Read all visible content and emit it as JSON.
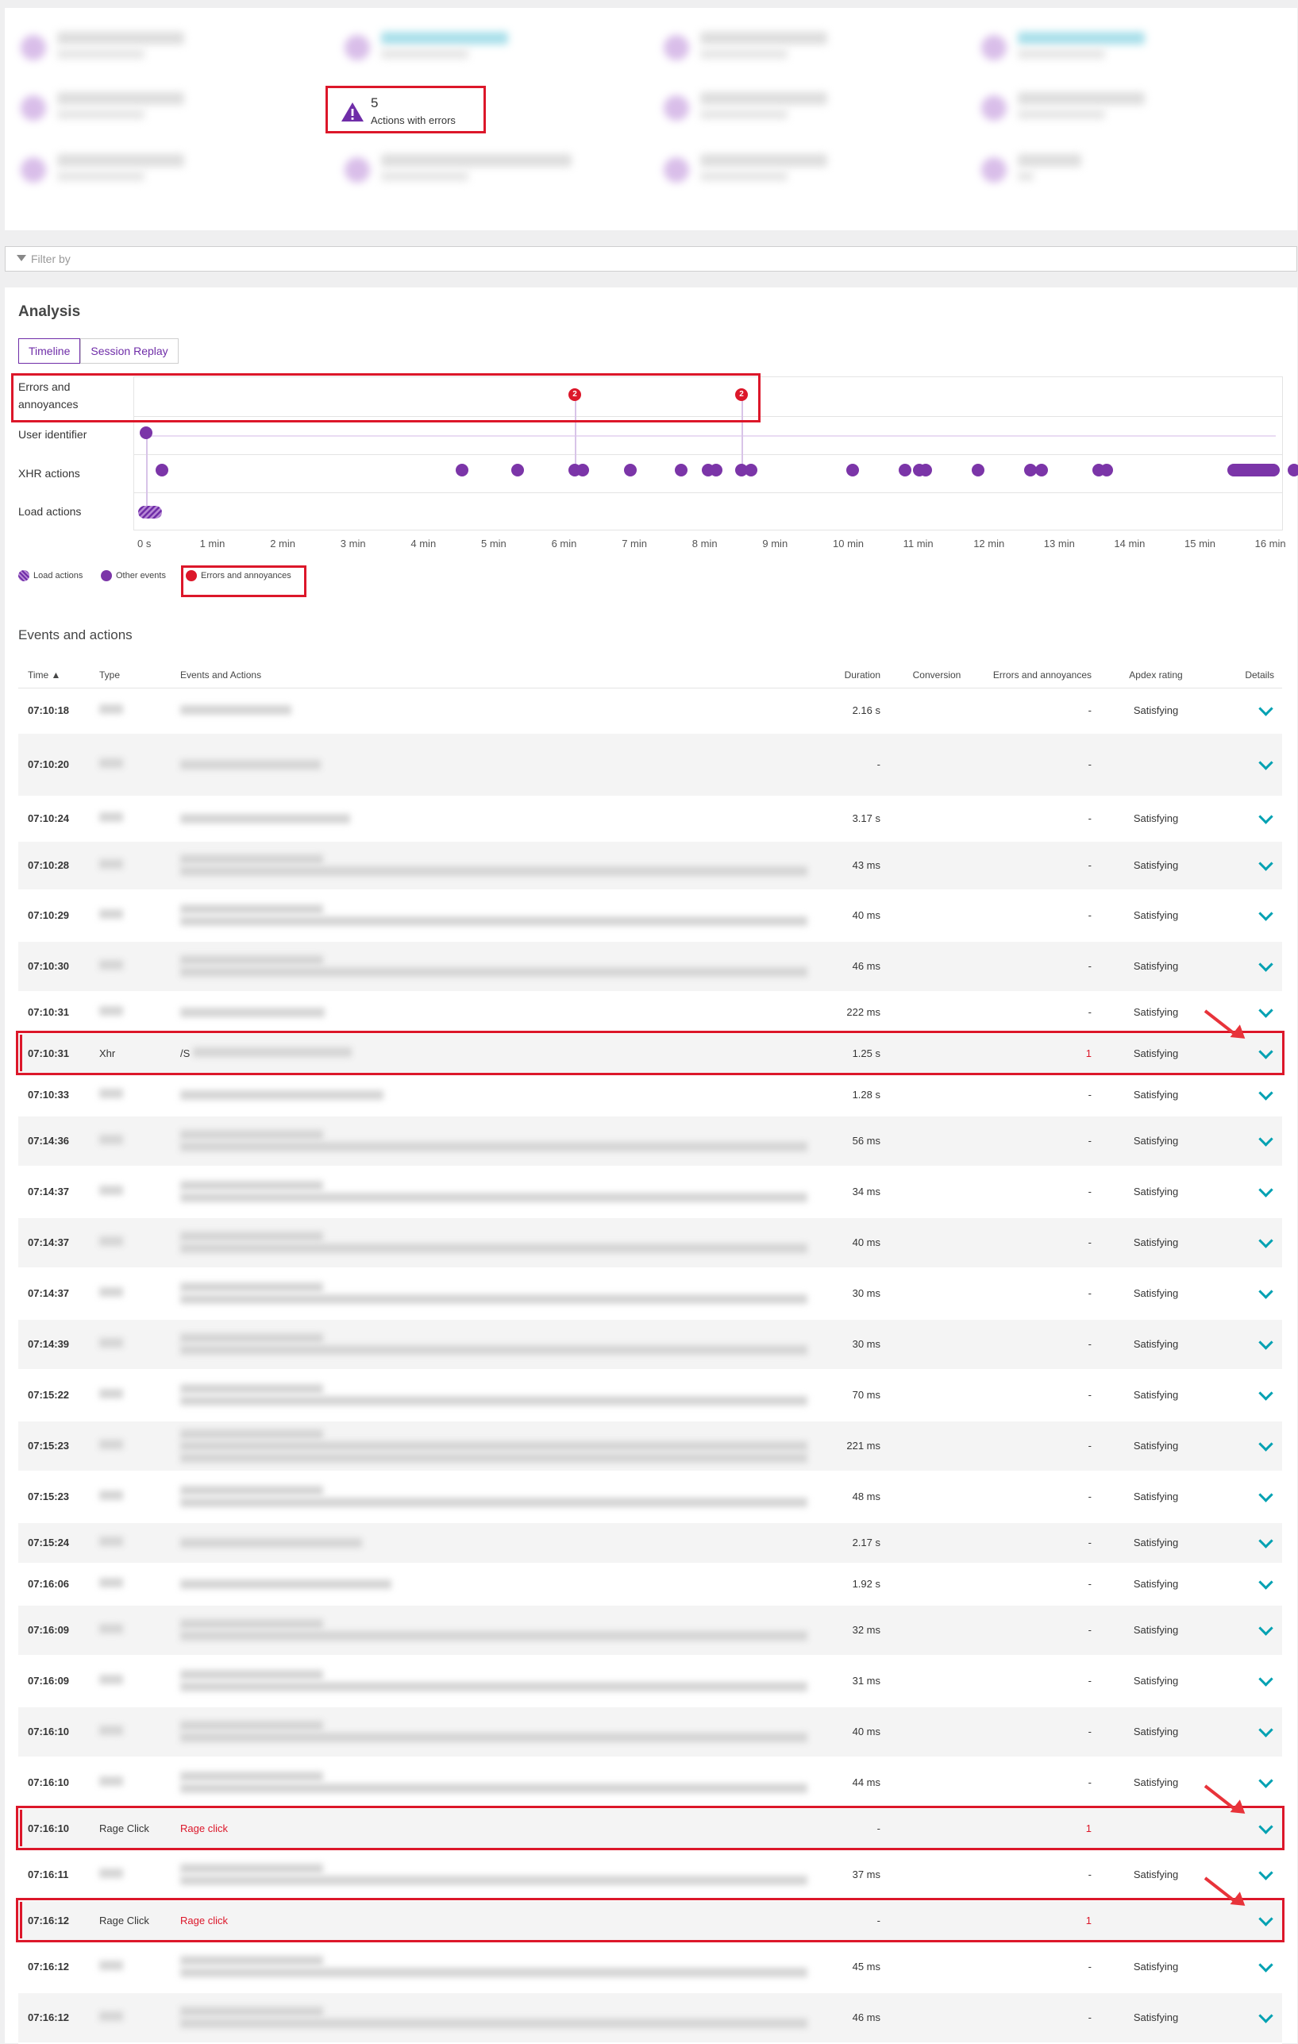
{
  "summary": {
    "highlight_value": "5",
    "highlight_label": "Actions with errors",
    "highlight_icon": "warning-triangle-icon"
  },
  "filter": {
    "placeholder": "Filter by"
  },
  "analysis": {
    "title": "Analysis",
    "tabs": [
      "Timeline",
      "Session Replay"
    ],
    "active_tab": "Timeline",
    "rows": [
      "Errors and annoyances",
      "User identifier",
      "XHR actions",
      "Load actions"
    ],
    "axis": [
      "0 s",
      "1 min",
      "2 min",
      "3 min",
      "4 min",
      "5 min",
      "6 min",
      "7 min",
      "8 min",
      "9 min",
      "10 min",
      "11 min",
      "12 min",
      "13 min",
      "14 min",
      "15 min",
      "16 min"
    ],
    "error_markers": [
      "2",
      "2"
    ],
    "legend": [
      "Load actions",
      "Other events",
      "Errors and annoyances"
    ],
    "colors": {
      "accent": "#6f2da8",
      "event": "#7b35a8",
      "error": "#dc172a",
      "link": "#00a1b2"
    }
  },
  "events": {
    "title": "Events and actions",
    "columns": [
      "Time ▲",
      "Type",
      "Events and Actions",
      "Duration",
      "Conversion",
      "Errors and annoyances",
      "Apdex rating",
      "Details"
    ],
    "rows": [
      {
        "time": "07:10:18",
        "type": "",
        "action": "",
        "duration": "2.16 s",
        "errors": "-",
        "apdex": "Satisfying",
        "h": 56,
        "lines": 1
      },
      {
        "time": "07:10:20",
        "type": "",
        "action": "",
        "duration": "-",
        "errors": "-",
        "apdex": "",
        "h": 80,
        "lines": 1
      },
      {
        "time": "07:10:24",
        "type": "",
        "action": "",
        "duration": "3.17 s",
        "errors": "-",
        "apdex": "Satisfying",
        "h": 56,
        "lines": 1
      },
      {
        "time": "07:10:28",
        "type": "",
        "action": "",
        "duration": "43 ms",
        "errors": "-",
        "apdex": "Satisfying",
        "h": 62,
        "lines": 2
      },
      {
        "time": "07:10:29",
        "type": "",
        "action": "",
        "duration": "40 ms",
        "errors": "-",
        "apdex": "Satisfying",
        "h": 64,
        "lines": 2
      },
      {
        "time": "07:10:30",
        "type": "",
        "action": "",
        "duration": "46 ms",
        "errors": "-",
        "apdex": "Satisfying",
        "h": 64,
        "lines": 2
      },
      {
        "time": "07:10:31",
        "type": "",
        "action": "",
        "duration": "222 ms",
        "errors": "-",
        "apdex": "Satisfying",
        "h": 52,
        "lines": 1
      },
      {
        "time": "07:10:31",
        "type": "Xhr",
        "action": "/S",
        "duration": "1.25 s",
        "errors": "1",
        "apdex": "Satisfying",
        "h": 52,
        "lines": 1,
        "hl": true
      },
      {
        "time": "07:10:33",
        "type": "",
        "action": "",
        "duration": "1.28 s",
        "errors": "-",
        "apdex": "Satisfying",
        "h": 52,
        "lines": 1
      },
      {
        "time": "07:14:36",
        "type": "",
        "action": "",
        "duration": "56 ms",
        "errors": "-",
        "apdex": "Satisfying",
        "h": 64,
        "lines": 2
      },
      {
        "time": "07:14:37",
        "type": "",
        "action": "",
        "duration": "34 ms",
        "errors": "-",
        "apdex": "Satisfying",
        "h": 64,
        "lines": 2
      },
      {
        "time": "07:14:37",
        "type": "",
        "action": "",
        "duration": "40 ms",
        "errors": "-",
        "apdex": "Satisfying",
        "h": 64,
        "lines": 2
      },
      {
        "time": "07:14:37",
        "type": "",
        "action": "",
        "duration": "30 ms",
        "errors": "-",
        "apdex": "Satisfying",
        "h": 64,
        "lines": 2
      },
      {
        "time": "07:14:39",
        "type": "",
        "action": "",
        "duration": "30 ms",
        "errors": "-",
        "apdex": "Satisfying",
        "h": 64,
        "lines": 2
      },
      {
        "time": "07:15:22",
        "type": "",
        "action": "",
        "duration": "70 ms",
        "errors": "-",
        "apdex": "Satisfying",
        "h": 64,
        "lines": 2
      },
      {
        "time": "07:15:23",
        "type": "",
        "action": "",
        "duration": "221 ms",
        "errors": "-",
        "apdex": "Satisfying",
        "h": 64,
        "lines": 3
      },
      {
        "time": "07:15:23",
        "type": "",
        "action": "",
        "duration": "48 ms",
        "errors": "-",
        "apdex": "Satisfying",
        "h": 64,
        "lines": 2
      },
      {
        "time": "07:15:24",
        "type": "",
        "action": "",
        "duration": "2.17 s",
        "errors": "-",
        "apdex": "Satisfying",
        "h": 52,
        "lines": 1
      },
      {
        "time": "07:16:06",
        "type": "",
        "action": "",
        "duration": "1.92 s",
        "errors": "-",
        "apdex": "Satisfying",
        "h": 52,
        "lines": 1
      },
      {
        "time": "07:16:09",
        "type": "",
        "action": "",
        "duration": "32 ms",
        "errors": "-",
        "apdex": "Satisfying",
        "h": 64,
        "lines": 2
      },
      {
        "time": "07:16:09",
        "type": "",
        "action": "",
        "duration": "31 ms",
        "errors": "-",
        "apdex": "Satisfying",
        "h": 64,
        "lines": 2
      },
      {
        "time": "07:16:10",
        "type": "",
        "action": "",
        "duration": "40 ms",
        "errors": "-",
        "apdex": "Satisfying",
        "h": 64,
        "lines": 2
      },
      {
        "time": "07:16:10",
        "type": "",
        "action": "",
        "duration": "44 ms",
        "errors": "-",
        "apdex": "Satisfying",
        "h": 64,
        "lines": 2
      },
      {
        "time": "07:16:10",
        "type": "Rage Click",
        "action": "Rage click",
        "duration": "-",
        "errors": "1",
        "apdex": "",
        "h": 52,
        "lines": 0,
        "hl": true
      },
      {
        "time": "07:16:11",
        "type": "",
        "action": "",
        "duration": "37 ms",
        "errors": "-",
        "apdex": "Satisfying",
        "h": 64,
        "lines": 2
      },
      {
        "time": "07:16:12",
        "type": "Rage Click",
        "action": "Rage click",
        "duration": "-",
        "errors": "1",
        "apdex": "",
        "h": 52,
        "lines": 0,
        "hl": true
      },
      {
        "time": "07:16:12",
        "type": "",
        "action": "",
        "duration": "45 ms",
        "errors": "-",
        "apdex": "Satisfying",
        "h": 64,
        "lines": 2
      },
      {
        "time": "07:16:12",
        "type": "",
        "action": "",
        "duration": "46 ms",
        "errors": "-",
        "apdex": "Satisfying",
        "h": 64,
        "lines": 2
      }
    ]
  }
}
